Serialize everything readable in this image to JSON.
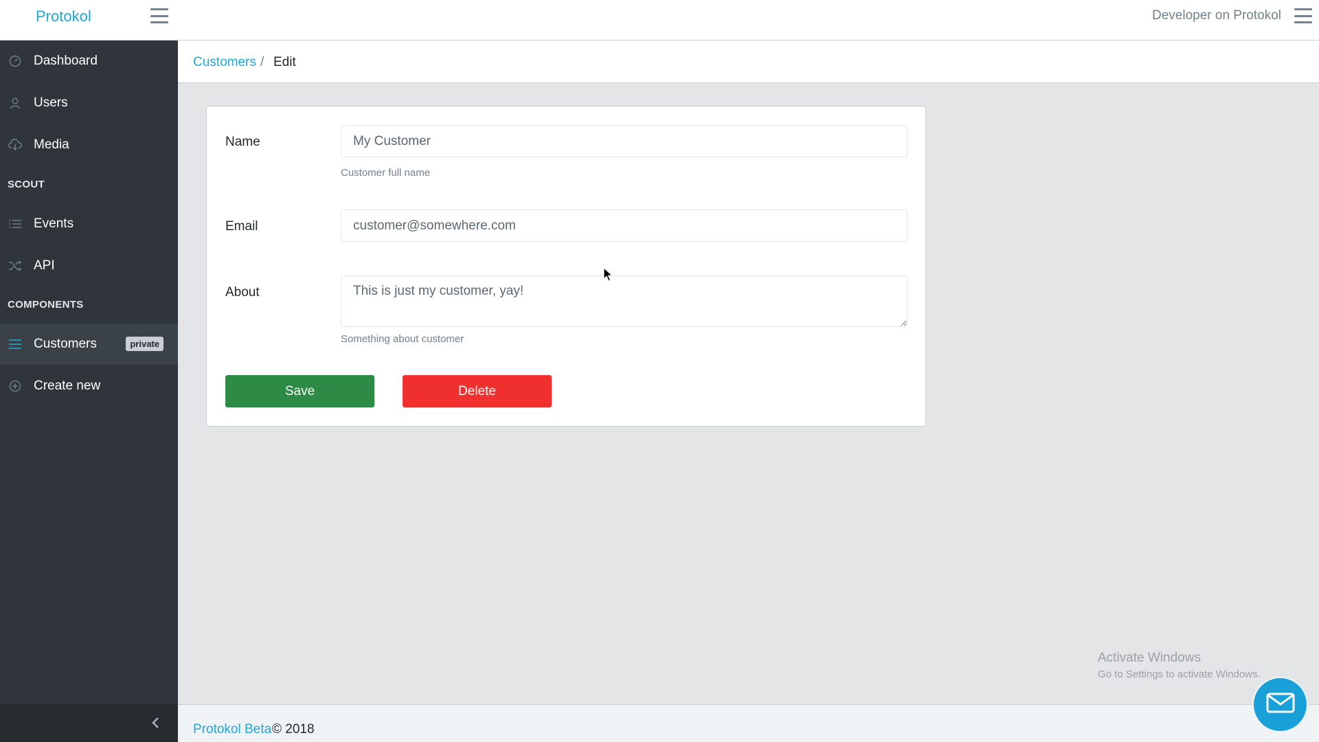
{
  "header": {
    "brand": "Protokol",
    "user_label": "Developer on Protokol"
  },
  "sidebar": {
    "items": [
      {
        "label": "Dashboard",
        "icon": "speedometer-icon"
      },
      {
        "label": "Users",
        "icon": "user-icon"
      },
      {
        "label": "Media",
        "icon": "cloud-download-icon"
      }
    ],
    "section_scout": "SCOUT",
    "scout_items": [
      {
        "label": "Events",
        "icon": "list-icon"
      },
      {
        "label": "API",
        "icon": "shuffle-icon"
      }
    ],
    "section_components": "COMPONENTS",
    "component_items": [
      {
        "label": "Customers",
        "icon": "menu-icon",
        "badge": "private",
        "active": true
      },
      {
        "label": "Create new",
        "icon": "plus-circle-icon"
      }
    ]
  },
  "breadcrumb": {
    "parent": "Customers",
    "separator": "/",
    "current": "Edit"
  },
  "form": {
    "name_label": "Name",
    "name_value": "My Customer",
    "name_help": "Customer full name",
    "email_label": "Email",
    "email_value": "customer@somewhere.com",
    "about_label": "About",
    "about_value": "This is just my customer, yay!",
    "about_help": "Something about customer",
    "save_label": "Save",
    "delete_label": "Delete"
  },
  "footer": {
    "link": "Protokol Beta",
    "copy": "© 2018"
  },
  "watermark": {
    "title": "Activate Windows",
    "subtitle": "Go to Settings to activate Windows."
  },
  "colors": {
    "accent": "#20a8d8",
    "save": "#2e8b45",
    "delete": "#f0302e",
    "sidebar_bg": "#2f353a"
  }
}
